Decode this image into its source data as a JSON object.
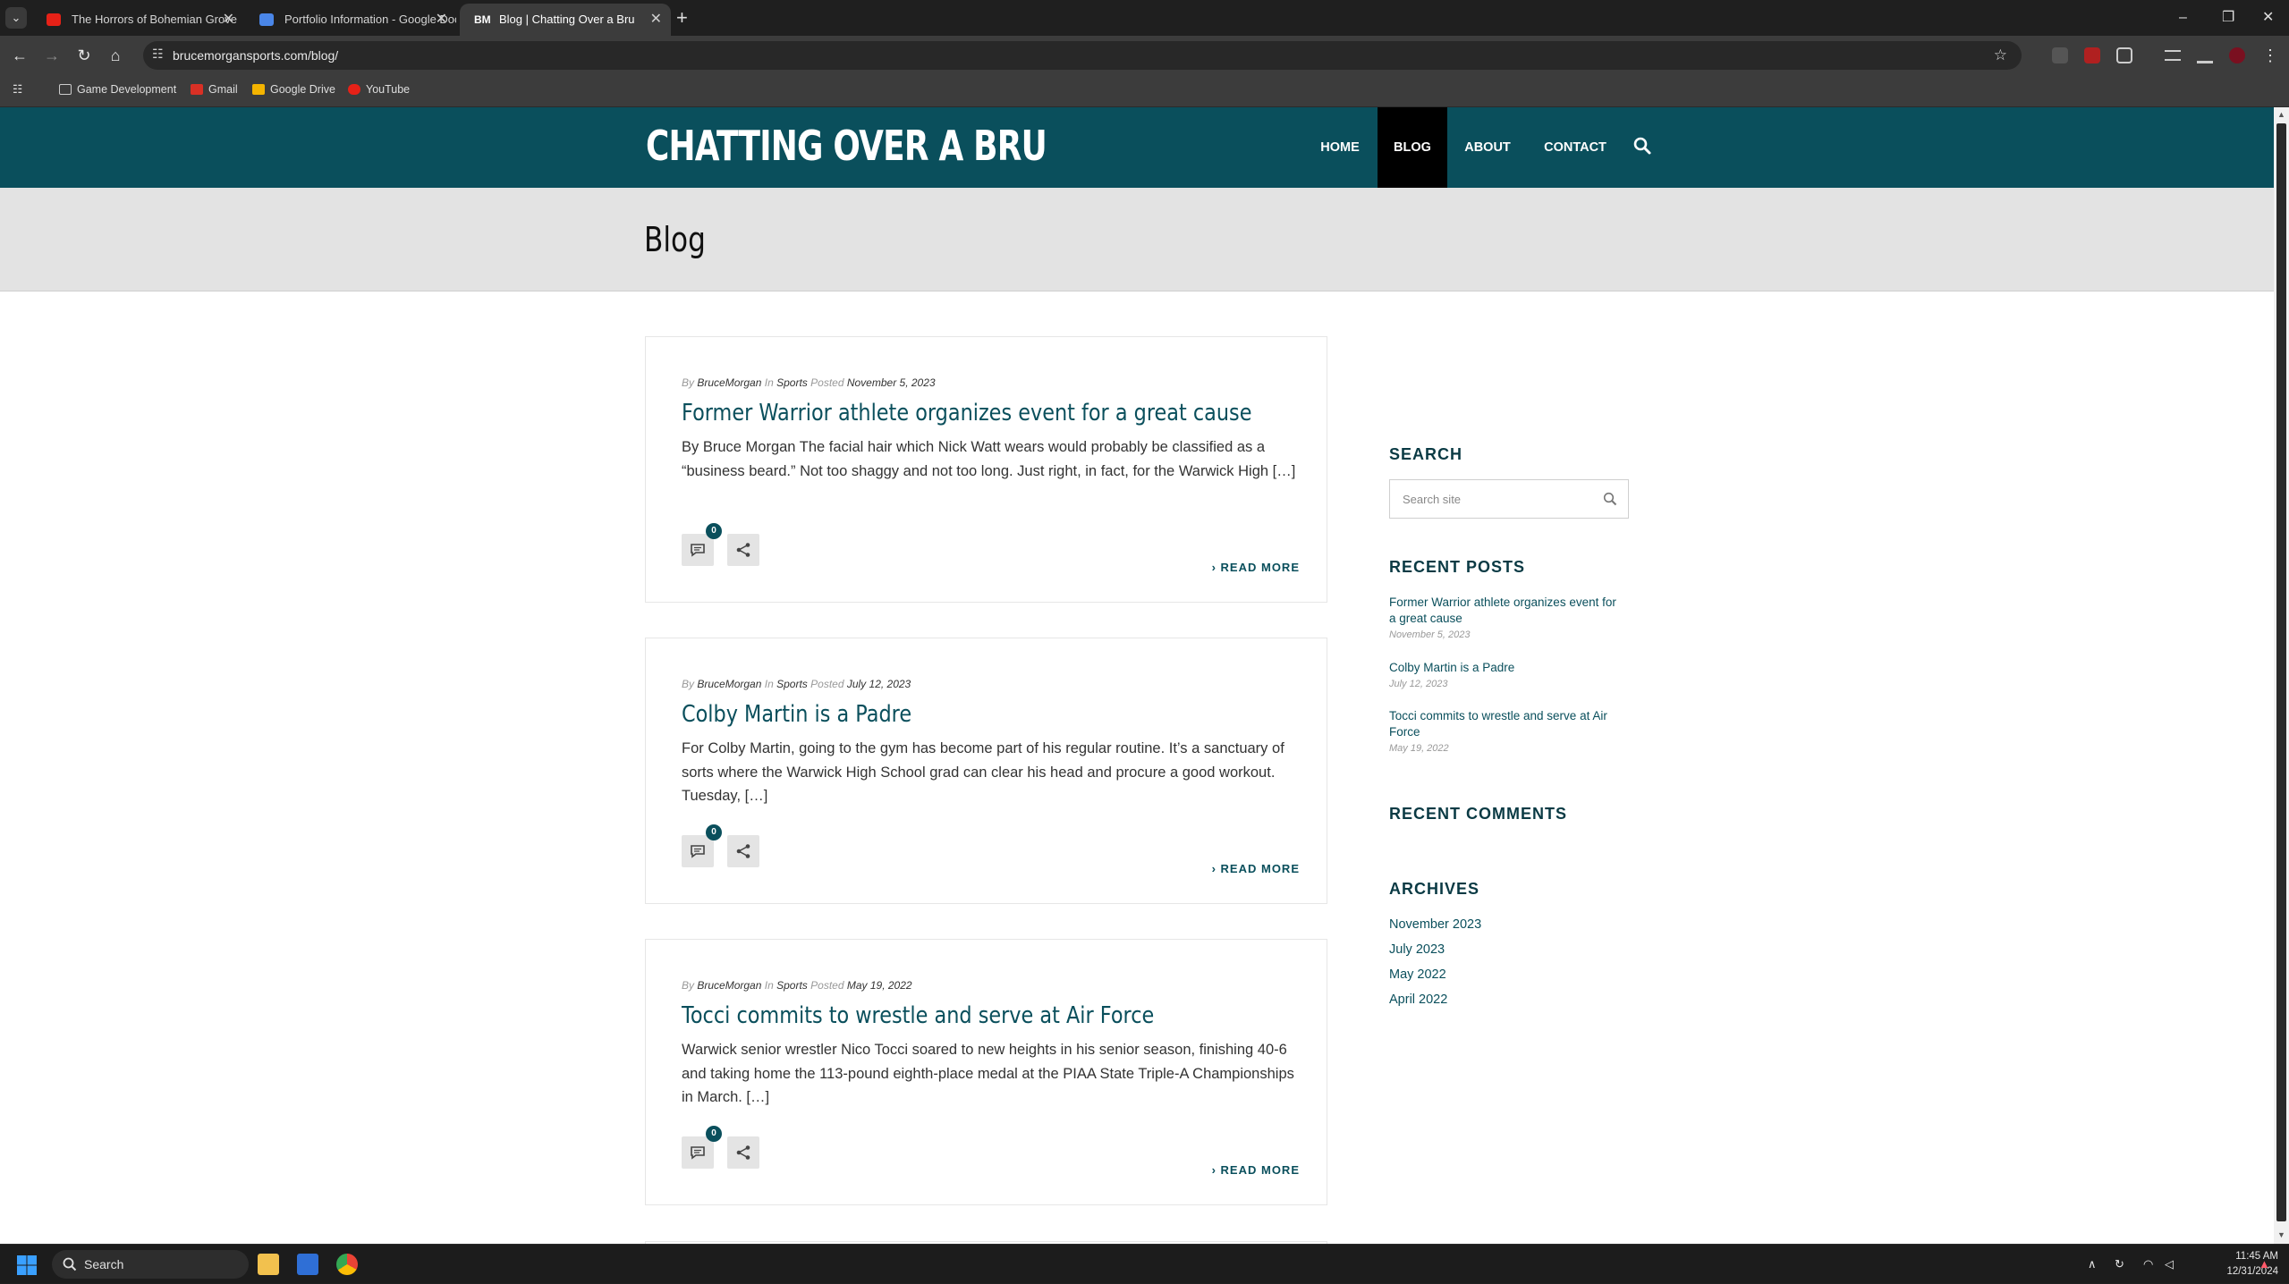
{
  "browser": {
    "tabs": [
      {
        "title": "The Horrors of Bohemian Grove"
      },
      {
        "title": "Portfolio Information - Google Docs"
      },
      {
        "title": "Blog | Chatting Over a Bru",
        "badge": "BM"
      }
    ],
    "url": "brucemorgansports.com/blog/",
    "bookmarks": [
      "Game Development",
      "Gmail",
      "Google Drive",
      "YouTube"
    ]
  },
  "site": {
    "logo": "CHATTING OVER A BRU",
    "nav": [
      "HOME",
      "BLOG",
      "ABOUT",
      "CONTACT"
    ],
    "active_nav": "BLOG",
    "accent_color": "#0a4f5c",
    "page_title": "Blog"
  },
  "posts": [
    {
      "author": "BruceMorgan",
      "category": "Sports",
      "date": "November 5, 2023",
      "title": "Former Warrior athlete organizes event for a great cause",
      "excerpt": "By Bruce Morgan The facial hair which Nick Watt wears would probably be classified as a “business beard.” Not too shaggy and not too long. Just right, in fact, for the Warwick High […]",
      "comments": "0",
      "read_more": "READ MORE"
    },
    {
      "author": "BruceMorgan",
      "category": "Sports",
      "date": "July 12, 2023",
      "title": "Colby Martin is a Padre",
      "excerpt": "For Colby Martin, going to the gym has become part of his regular routine. It’s a sanctuary of sorts where the Warwick High School grad can clear his head and procure a good workout. Tuesday, […]",
      "comments": "0",
      "read_more": "READ MORE"
    },
    {
      "author": "BruceMorgan",
      "category": "Sports",
      "date": "May 19, 2022",
      "title": "Tocci commits to wrestle and serve at Air Force",
      "excerpt": "Warwick senior wrestler Nico Tocci soared to new heights in his senior season, finishing 40-6 and taking home the 113-pound eighth-place medal at the PIAA State Triple-A Championships in March. […]",
      "comments": "0",
      "read_more": "READ MORE"
    }
  ],
  "meta_labels": {
    "by": "By",
    "in": "In",
    "posted": "Posted"
  },
  "sidebar": {
    "search_title": "SEARCH",
    "search_placeholder": "Search site",
    "recent_posts_title": "RECENT POSTS",
    "recent_posts": [
      {
        "title": "Former Warrior athlete organizes event for a great cause",
        "date": "November 5, 2023"
      },
      {
        "title": "Colby Martin is a Padre",
        "date": "July 12, 2023"
      },
      {
        "title": "Tocci commits to wrestle and serve at Air Force",
        "date": "May 19, 2022"
      }
    ],
    "recent_comments_title": "RECENT COMMENTS",
    "archives_title": "ARCHIVES",
    "archives": [
      "November 2023",
      "July 2023",
      "May 2022",
      "April 2022"
    ]
  },
  "taskbar": {
    "search_label": "Search",
    "time": "11:45 AM",
    "date": "12/31/2024"
  }
}
